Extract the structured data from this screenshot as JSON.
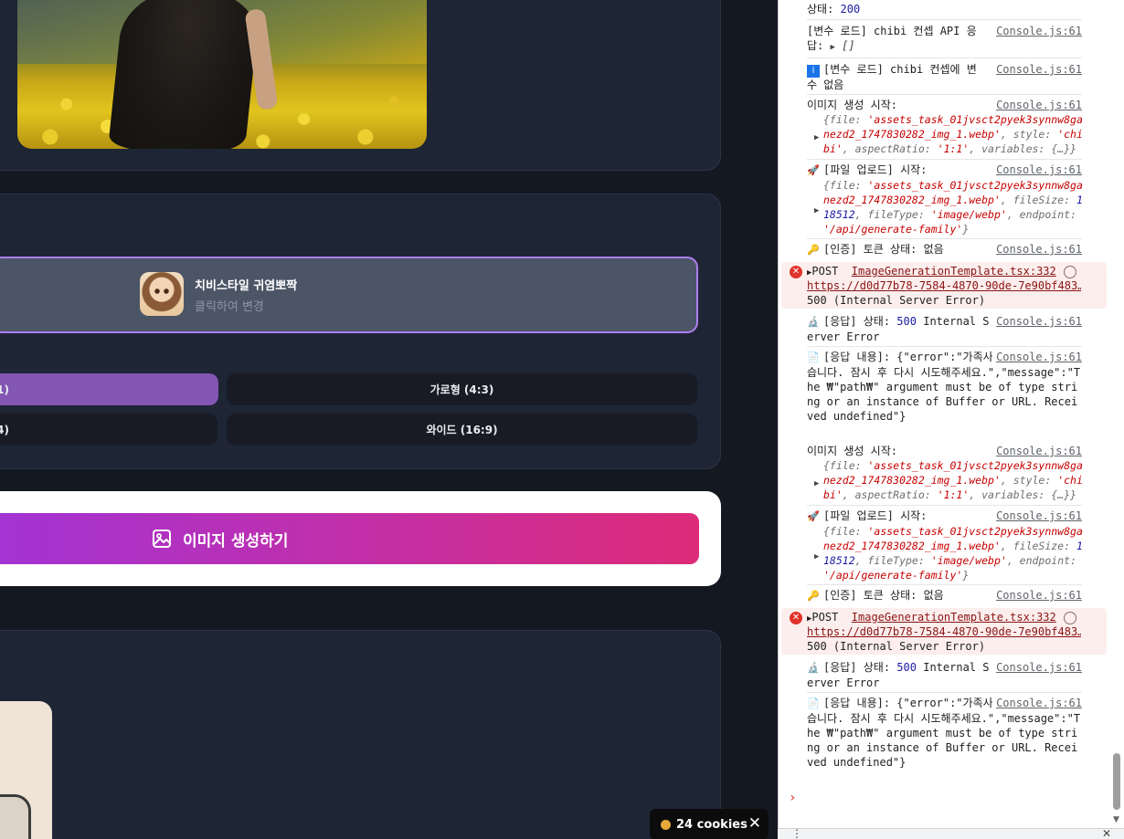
{
  "app": {
    "style_selector": {
      "name": "치비스타일 귀염뽀짝",
      "hint": "클릭하여 변경"
    },
    "ratios": [
      {
        "label": "1)",
        "selected": true
      },
      {
        "label": "가로형 (4:3)",
        "selected": false
      },
      {
        "label": "4)",
        "selected": false
      },
      {
        "label": "와이드 (16:9)",
        "selected": false
      }
    ],
    "generate_button": {
      "label": "이미지 생성하기"
    },
    "cookie_badge": {
      "label": "24 cookies",
      "close": "✕"
    }
  },
  "console": {
    "source": "Console.js:61",
    "rows": {
      "status200": {
        "text": "상태:",
        "value": "200"
      },
      "chibi_api": {
        "text": "[변수 로드] chibi 컨셉 API 응답:",
        "obj": "[]"
      },
      "chibi_none": {
        "text": "[변수 로드] chibi 컨셉에 변수 없음"
      },
      "gen_start_1": {
        "text": "이미지 생성 시작:"
      },
      "upload_start_1": {
        "text": "[파일 업로드] 시작:"
      },
      "token_1": {
        "text": "[인증] 토큰 상태: 없음"
      },
      "resp_status_1": {
        "text": "[응답] 상태:",
        "code": "500",
        "rest": "Internal Server Error"
      },
      "resp_body_1": {
        "text": "[응답 내용]: {\"error\":\"가족사진 생성에 실패했습니다. 잠시 후 다시 시도해주세요.\",\"message\":\"The ₩\"path₩\" argument must be of type string or an instance of Buffer or URL. Received undefined\"}"
      },
      "gen_start_2": {
        "text": "이미지 생성 시작:"
      },
      "upload_start_2": {
        "text": "[파일 업로드] 시작:"
      },
      "token_2": {
        "text": "[인증] 토큰 상태: 없음"
      },
      "resp_status_2": {
        "text": "[응답] 상태:",
        "code": "500",
        "rest": "Internal Server Error"
      },
      "resp_body_2": {
        "text": "[응답 내용]: {\"error\":\"가족사진 생성에 실패했습니다. 잠시 후 다시 시도해주세요.\",\"message\":\"The ₩\"path₩\" argument must be of type string or an instance of Buffer or URL. Received undefined\"}"
      }
    },
    "gen_obj": {
      "pre": "{file: ",
      "file": "'assets_task_01jvsct2pyek3synnw8ganezd2_1747830282_img_1.webp'",
      "mid": ", style: ",
      "style": "'chibi'",
      "mid2": ", aspectRatio: ",
      "ratio": "'1:1'",
      "tail": ", variables: {…}}"
    },
    "upload_obj": {
      "pre": "{file: ",
      "file": "'assets_task_01jvsct2pyek3synnw8ganezd2_1747830282_img_1.webp'",
      "mid": ", fileSize: ",
      "size": "118512",
      "mid2": ", fileType: ",
      "type": "'image/webp'",
      "mid3": ", endpoint: ",
      "endpoint": "'/api/generate-family'",
      "tail": "}"
    },
    "error": {
      "post": "POST",
      "source": "ImageGenerationTemplate.tsx:332",
      "url": "https://d0d77b78-7584-4870-90de-7e90bf483…",
      "status": "500 (Internal Server Error)"
    },
    "colors": {
      "error_bg": "#fceeed",
      "error_text": "#8a1313",
      "string": "#c80000",
      "number": "#1a1aa6"
    }
  }
}
